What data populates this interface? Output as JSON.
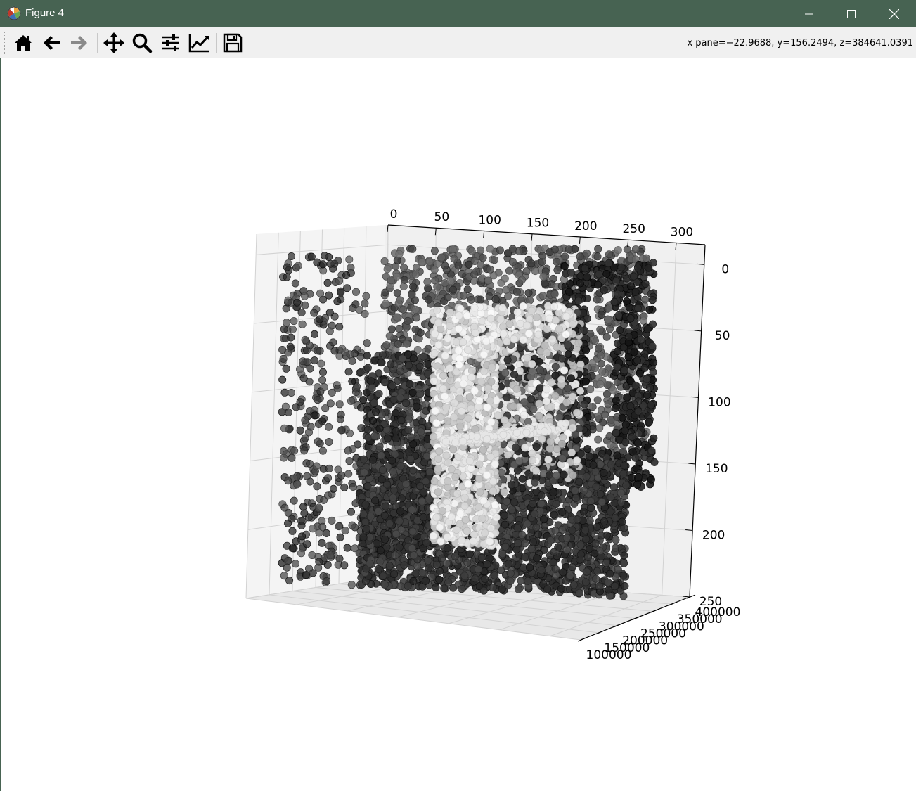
{
  "window": {
    "title": "Figure 4",
    "controls": {
      "minimize": "minimize",
      "maximize": "maximize",
      "close": "close"
    }
  },
  "toolbar": {
    "buttons": [
      {
        "name": "home",
        "icon": "home-icon",
        "enabled": true
      },
      {
        "name": "back",
        "icon": "arrow-left-icon",
        "enabled": true
      },
      {
        "name": "forward",
        "icon": "arrow-right-icon",
        "enabled": false
      },
      {
        "name": "pan",
        "icon": "move-icon",
        "enabled": true
      },
      {
        "name": "zoom",
        "icon": "magnifier-icon",
        "enabled": true
      },
      {
        "name": "configure-subplots",
        "icon": "sliders-icon",
        "enabled": true
      },
      {
        "name": "edit-axis",
        "icon": "line-chart-icon",
        "enabled": true
      },
      {
        "name": "save",
        "icon": "floppy-disk-icon",
        "enabled": true
      }
    ],
    "coordinates": "x pane=−22.9688, y=156.2494, z=384641.0391"
  },
  "colors": {
    "titlebar": "#476352",
    "toolbar": "#f0f0f0",
    "pane": "#f2f2f2",
    "grid": "#d2d2d2",
    "points_dark": "#222222",
    "points_light": "#f0f0f0"
  },
  "chart_data": {
    "type": "scatter",
    "projection": "3d",
    "colormap": "gray",
    "x_axis": {
      "ticks": [
        "0",
        "50",
        "100",
        "150",
        "200",
        "250",
        "300"
      ],
      "range": [
        0,
        330
      ]
    },
    "y_axis": {
      "ticks": [
        "0",
        "50",
        "100",
        "150",
        "200",
        "250"
      ],
      "range": [
        250,
        -15
      ],
      "inverted": true
    },
    "z_axis": {
      "ticks": [
        "100000",
        "150000",
        "200000",
        "250000",
        "300000",
        "350000",
        "400000"
      ],
      "range": [
        100000,
        400000
      ]
    },
    "grid": true,
    "regions": [
      {
        "label": "background-wall",
        "x": [
          0,
          300
        ],
        "y": [
          0,
          240
        ],
        "shade": "dark"
      },
      {
        "label": "box-front-face",
        "x": [
          60,
          170
        ],
        "y": [
          40,
          210
        ],
        "shade": "light"
      },
      {
        "label": "box-right-face",
        "x": [
          170,
          220
        ],
        "y": [
          25,
          190
        ],
        "shade": "mixed"
      },
      {
        "label": "floor",
        "x": [
          0,
          290
        ],
        "y": [
          150,
          245
        ],
        "shade": "dark"
      },
      {
        "label": "right-frame",
        "x": [
          250,
          300
        ],
        "y": [
          0,
          170
        ],
        "shade": "dark"
      }
    ]
  }
}
